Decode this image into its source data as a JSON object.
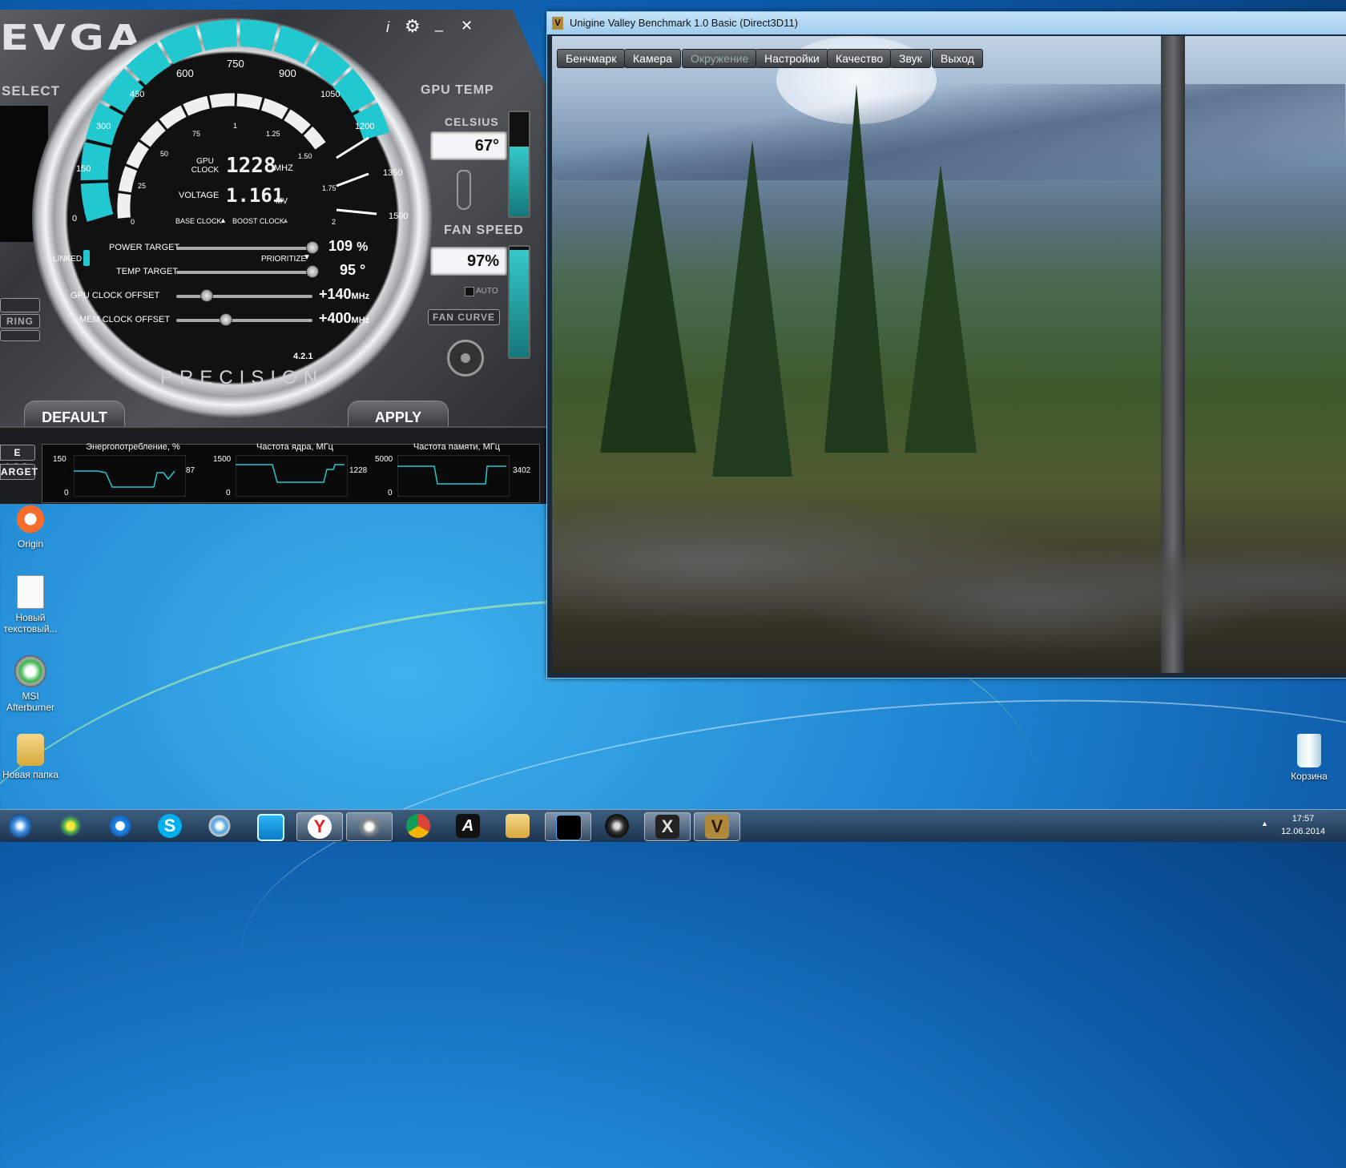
{
  "desktop": {
    "icons": [
      {
        "label": "Origin"
      },
      {
        "label": "Новый текстовый..."
      },
      {
        "label": "MSI Afterburner"
      },
      {
        "label": "Новая папка"
      },
      {
        "label": "Корзина"
      }
    ]
  },
  "evga": {
    "logo": "EVGA",
    "select_label": "SELECT",
    "controls": {
      "info": "i",
      "minimize": "_",
      "close": "✕"
    },
    "gauge_outer_ticks": [
      "0",
      "150",
      "300",
      "450",
      "600",
      "750",
      "900",
      "1050",
      "1200",
      "1350",
      "1500"
    ],
    "gauge_inner_ticks": [
      "0",
      "25",
      "50",
      "75",
      "1",
      "1.25",
      "1.50",
      "1.75",
      "2"
    ],
    "gpu_clock_label": "GPU CLOCK",
    "gpu_clock_value": "1228",
    "gpu_clock_unit": "MHZ",
    "voltage_label": "VOLTAGE",
    "voltage_value": "1.161",
    "voltage_unit": "MV",
    "base_clock_label": "BASE CLOCK",
    "boost_clock_label": "BOOST CLOCK",
    "power_target_label": "POWER TARGET",
    "power_target_value": "109",
    "power_target_unit": "%",
    "linked_label": "LINKED",
    "prioritize_label": "PRIORITIZE",
    "temp_target_label": "TEMP TARGET",
    "temp_target_value": "95",
    "temp_target_unit": "°",
    "gpu_clock_offset_label": "GPU CLOCK OFFSET",
    "gpu_clock_offset_value": "+140",
    "mem_clock_offset_label": "MEM CLOCK OFFSET",
    "mem_clock_offset_value": "+400",
    "offset_unit": "MHz",
    "version": "4.2.1",
    "product_name": "PRECISION",
    "gpu_temp_label": "GPU TEMP",
    "celsius_label": "CELSIUS",
    "temp_value": "67°",
    "temp_level": 0.67,
    "fan_speed_label": "FAN SPEED",
    "fan_value": "97%",
    "fan_level": 0.97,
    "auto_label": "AUTO",
    "fan_curve_label": "FAN CURVE",
    "ring_label": "RING",
    "default_label": "DEFAULT",
    "apply_label": "APPLY",
    "log_label": "E LOG",
    "target_label": "ARGET",
    "accent": "#22c8d0"
  },
  "graphs": [
    {
      "title": "Энергопотребление, %",
      "max": "150",
      "min": "0",
      "current": "87"
    },
    {
      "title": "Частота ядра, МГц",
      "max": "1500",
      "min": "0",
      "current": "1228"
    },
    {
      "title": "Частота памяти, МГц",
      "max": "5000",
      "min": "0",
      "current": "3402"
    }
  ],
  "valley": {
    "title": "Unigine Valley Benchmark 1.0 Basic (Direct3D11)",
    "menu": [
      "Бенчмарк",
      "Камера",
      "Окружение",
      "Настройки",
      "Качество",
      "Звук",
      "Выход"
    ]
  },
  "taskbar": {
    "time": "17:57",
    "date": "12.06.2014"
  }
}
